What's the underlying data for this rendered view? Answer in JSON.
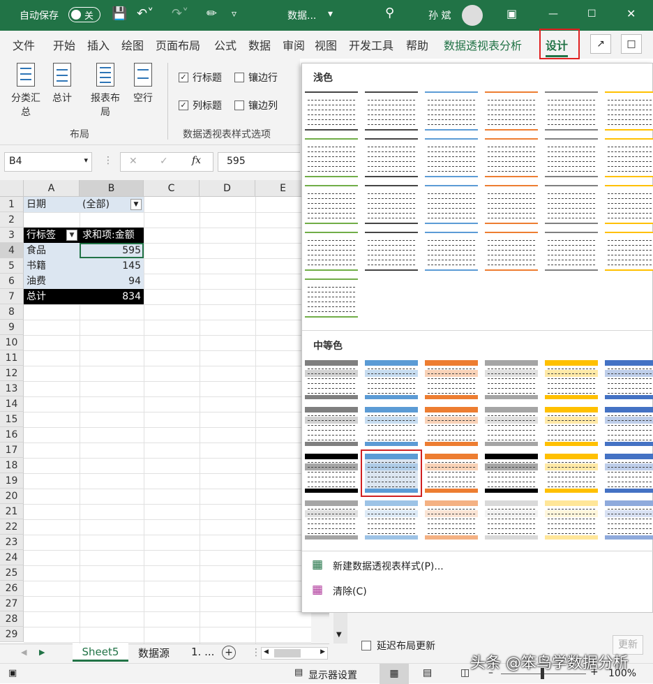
{
  "titlebar": {
    "autosave_label": "自动保存",
    "autosave_state": "关",
    "file_title": "数据...",
    "user": "孙 斌",
    "accent": "#217346"
  },
  "tabs": [
    "文件",
    "开始",
    "插入",
    "绘图",
    "页面布局",
    "公式",
    "数据",
    "审阅",
    "视图",
    "开发工具",
    "帮助",
    "数据透视表分析",
    "设计"
  ],
  "ribbon": {
    "layout_buttons": [
      "分类汇总",
      "总计",
      "报表布局",
      "空行"
    ],
    "layout_group": "布局",
    "options": [
      {
        "label": "行标题",
        "checked": true
      },
      {
        "label": "镶边行",
        "checked": false
      },
      {
        "label": "列标题",
        "checked": true
      },
      {
        "label": "镶边列",
        "checked": false
      }
    ],
    "options_group": "数据透视表样式选项"
  },
  "formula": {
    "namebox": "B4",
    "value": "595",
    "fx": "fx"
  },
  "columns": [
    "A",
    "B",
    "C",
    "D",
    "E"
  ],
  "rows": [
    "1",
    "2",
    "3",
    "4",
    "5",
    "6",
    "7",
    "8",
    "9",
    "10",
    "11",
    "12",
    "13",
    "14",
    "15",
    "16",
    "17",
    "18",
    "19",
    "20",
    "21",
    "22",
    "23",
    "24",
    "25",
    "26",
    "27",
    "28",
    "29"
  ],
  "pivot": {
    "filter_label": "日期",
    "filter_value": "(全部)",
    "row_header": "行标签",
    "value_header": "求和项:金额",
    "items": [
      {
        "label": "食品",
        "value": "595"
      },
      {
        "label": "书籍",
        "value": "145"
      },
      {
        "label": "油费",
        "value": "94"
      }
    ],
    "total_label": "总计",
    "total_value": "834"
  },
  "gallery": {
    "light_title": "浅色",
    "medium_title": "中等色",
    "light_colors": [
      "#444444",
      "#444444",
      "#5b9bd5",
      "#ed7d31",
      "#7f7f7f",
      "#ffc000",
      "#70ad47",
      "#444444",
      "#5b9bd5",
      "#ed7d31",
      "#7f7f7f",
      "#ffc000",
      "#70ad47",
      "#444444",
      "#5b9bd5",
      "#ed7d31",
      "#7f7f7f",
      "#ffc000",
      "#70ad47",
      "#444444",
      "#5b9bd5",
      "#ed7d31",
      "#7f7f7f",
      "#ffc000",
      "#70ad47"
    ],
    "medium_colors": [
      "#7f7f7f",
      "#5b9bd5",
      "#ed7d31",
      "#a5a5a5",
      "#ffc000",
      "#4472c4",
      "#7f7f7f",
      "#5b9bd5",
      "#ed7d31",
      "#a5a5a5",
      "#ffc000",
      "#4472c4",
      "#000000",
      "#5b9bd5",
      "#ed7d31",
      "#000000",
      "#ffc000",
      "#4472c4",
      "#a5a5a5",
      "#9dc3e6",
      "#f4b183",
      "#d9d9d9",
      "#ffe699",
      "#8faadc"
    ],
    "new_style": "新建数据透视表样式(P)...",
    "clear": "清除(C)"
  },
  "sheets": [
    "Sheet5",
    "数据源",
    "1. ..."
  ],
  "pane": {
    "defer_label": "延迟布局更新",
    "update_button": "更新"
  },
  "status": {
    "display": "显示器设置",
    "zoom": "100%"
  },
  "watermark": "头条 @笨鸟学数据分析"
}
